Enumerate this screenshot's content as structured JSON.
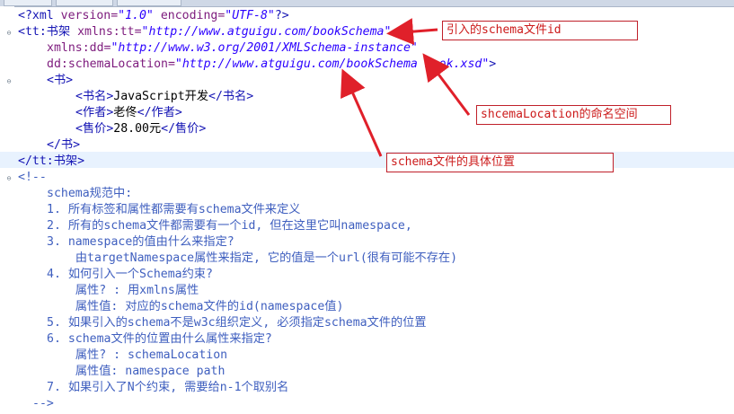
{
  "code": {
    "decl_open": "<?xml ",
    "decl_version_attr": "version=",
    "decl_version_val": "\"1.0\"",
    "decl_encoding_attr": " encoding=",
    "decl_encoding_val": "\"UTF-8\"",
    "decl_close": "?>",
    "root_open": "<tt:书架 ",
    "root_xmlns_attr": "xmlns:tt=",
    "root_xmlns_val": "\"http://www.atguigu.com/bookSchema\"",
    "xsi_attr": "xmlns:dd=",
    "xsi_val": "\"http://www.w3.org/2001/XMLSchema-instance\"",
    "loc_attr": "dd:schemaLocation=",
    "loc_val": "\"http://www.atguigu.com/bookSchema book.xsd\"",
    "loc_close": ">",
    "book_open": "<书>",
    "name_open": "<书名>",
    "name_text": "JavaScript开发",
    "name_close": "</书名>",
    "author_open": "<作者>",
    "author_text": "老佟",
    "author_close": "</作者>",
    "price_open": "<售价>",
    "price_text": "28.00元",
    "price_close": "</售价>",
    "book_close": "</书>",
    "root_close": "</tt:书架>",
    "comment_open": "<!--",
    "notes": [
      "schema规范中:",
      "1. 所有标签和属性都需要有schema文件来定义",
      "2. 所有的schema文件都需要有一个id, 但在这里它叫namespace,",
      "3. namespace的值由什么来指定?",
      "   由targetNamespace属性来指定, 它的值是一个url(很有可能不存在)",
      "4. 如何引入一个Schema约束?",
      "   属性? : 用xmlns属性",
      "   属性值: 对应的schema文件的id(namespace值)",
      "5. 如果引入的schema不是w3c组织定义, 必须指定schema文件的位置",
      "6. schema文件的位置由什么属性来指定?",
      "   属性? : schemaLocation",
      "   属性值: namespace path",
      "7. 如果引入了N个约束, 需要给n-1个取别名",
      "-->"
    ]
  },
  "callouts": {
    "schema_id": "引入的schema文件id",
    "namespace": "shcemaLocation的命名空间",
    "location": "schema文件的具体位置"
  },
  "colors": {
    "tag": "#1414b4",
    "attr": "#7d1b7d",
    "value": "#2a00ff",
    "comment": "#3f5fbf",
    "annotation": "#e0202a"
  },
  "icons": {
    "fold_open": "minus-fold-icon",
    "fold_closed": "plus-fold-icon"
  }
}
